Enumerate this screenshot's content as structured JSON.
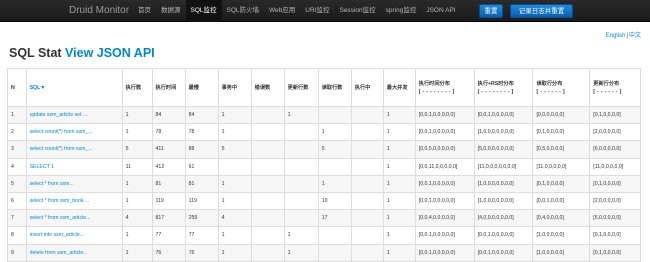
{
  "navbar": {
    "brand": "Druid Monitor",
    "items": [
      "首页",
      "数据源",
      "SQL监控",
      "SQL防火墙",
      "Web应用",
      "URI监控",
      "Session监控",
      "spring监控",
      "JSON API"
    ],
    "active_index": 2,
    "reset_label": "重置",
    "log_reset_label": "记录日志并重置"
  },
  "lang": {
    "english": "English",
    "sep": "|",
    "chinese": "中文"
  },
  "heading": {
    "title": "SQL Stat ",
    "link": "View JSON API"
  },
  "table": {
    "headers": [
      {
        "label": "N"
      },
      {
        "label": "SQL▼"
      },
      {
        "label": "执行数"
      },
      {
        "label": "执行时间"
      },
      {
        "label": "最慢"
      },
      {
        "label": "事务中"
      },
      {
        "label": "错误数"
      },
      {
        "label": "更新行数"
      },
      {
        "label": "读取行数"
      },
      {
        "label": "执行中"
      },
      {
        "label": "最大并发"
      },
      {
        "label": "执行时间分布",
        "sub": "[ - - - - - - - - ]"
      },
      {
        "label": "执行+RS时分布",
        "sub": "[ - - - - - - - - ]"
      },
      {
        "label": "读取行分布",
        "sub": "[ - - - - - - ]"
      },
      {
        "label": "更新行分布",
        "sub": "[ - - - - - - ]"
      }
    ],
    "rows": [
      [
        "1",
        "update ssm_article set ...",
        "1",
        "84",
        "84",
        "1",
        "",
        "1",
        "",
        "",
        "1",
        "[0,0,1,0,0,0,0,0]",
        "[0,0,1,0,0,0,0,0]",
        "[0,0,0,0,0,0]",
        "[0,1,0,0,0,0]"
      ],
      [
        "2",
        "select count(*) from ssm_...",
        "1",
        "78",
        "78",
        "1",
        "",
        "",
        "1",
        "",
        "1",
        "[0,0,1,0,0,0,0,0]",
        "[1,0,0,0,0,0,0,0]",
        "[0,1,0,0,0,0]",
        "[2,0,0,0,0,0]"
      ],
      [
        "3",
        "select count(*) from ssm_...",
        "5",
        "411",
        "88",
        "5",
        "",
        "",
        "5",
        "",
        "1",
        "[0,0,5,0,0,0,0,0]",
        "[5,0,0,0,0,0,0,0]",
        "[0,5,0,0,0,0]",
        "[6,0,0,0,0,0]"
      ],
      [
        "4",
        "SELECT 1",
        "11",
        "412",
        "61",
        "",
        "",
        "",
        "",
        "",
        "1",
        "[0,0,11,0,0,0,0,0]",
        "[11,0,0,0,0,0,0,0]",
        "[11,0,0,0,0,0]",
        "[11,0,0,0,0,0]"
      ],
      [
        "5",
        "select * from ssm...",
        "1",
        "81",
        "81",
        "1",
        "",
        "",
        "1",
        "",
        "1",
        "[0,0,1,0,0,0,0,0]",
        "[1,0,0,0,0,0,0,0]",
        "[0,1,0,0,0,0]",
        "[0,1,0,0,0,0]"
      ],
      [
        "6",
        "select * from ssm_book ...",
        "1",
        "119",
        "119",
        "1",
        "",
        "",
        "10",
        "",
        "1",
        "[0,0,1,0,0,0,0,0]",
        "[1,0,0,0,0,0,0,0]",
        "[0,0,1,0,0,0]",
        "[2,0,0,0,0,0]"
      ],
      [
        "7",
        "select * from ssm_article...",
        "4",
        "817",
        "259",
        "4",
        "",
        "",
        "17",
        "",
        "1",
        "[0,0,4,0,0,0,0,0]",
        "[4,0,0,0,0,0,0,0]",
        "[0,4,0,0,0,0]",
        "[5,0,0,0,0,0]"
      ],
      [
        "8",
        "insert into ssm_article...",
        "1",
        "77",
        "77",
        "1",
        "",
        "1",
        "",
        "",
        "1",
        "[0,0,1,0,0,0,0,0]",
        "[0,0,1,0,0,0,0,0]",
        "[1,0,0,0,0,0]",
        "[0,1,0,0,0,0]"
      ],
      [
        "9",
        "delete from ssm_article...",
        "1",
        "76",
        "76",
        "1",
        "",
        "1",
        "",
        "",
        "1",
        "[0,0,1,0,0,0,0,0]",
        "[0,0,1,0,0,0,0,0]",
        "[1,0,0,0,0,0]",
        "[0,1,0,0,0,0]"
      ]
    ]
  }
}
